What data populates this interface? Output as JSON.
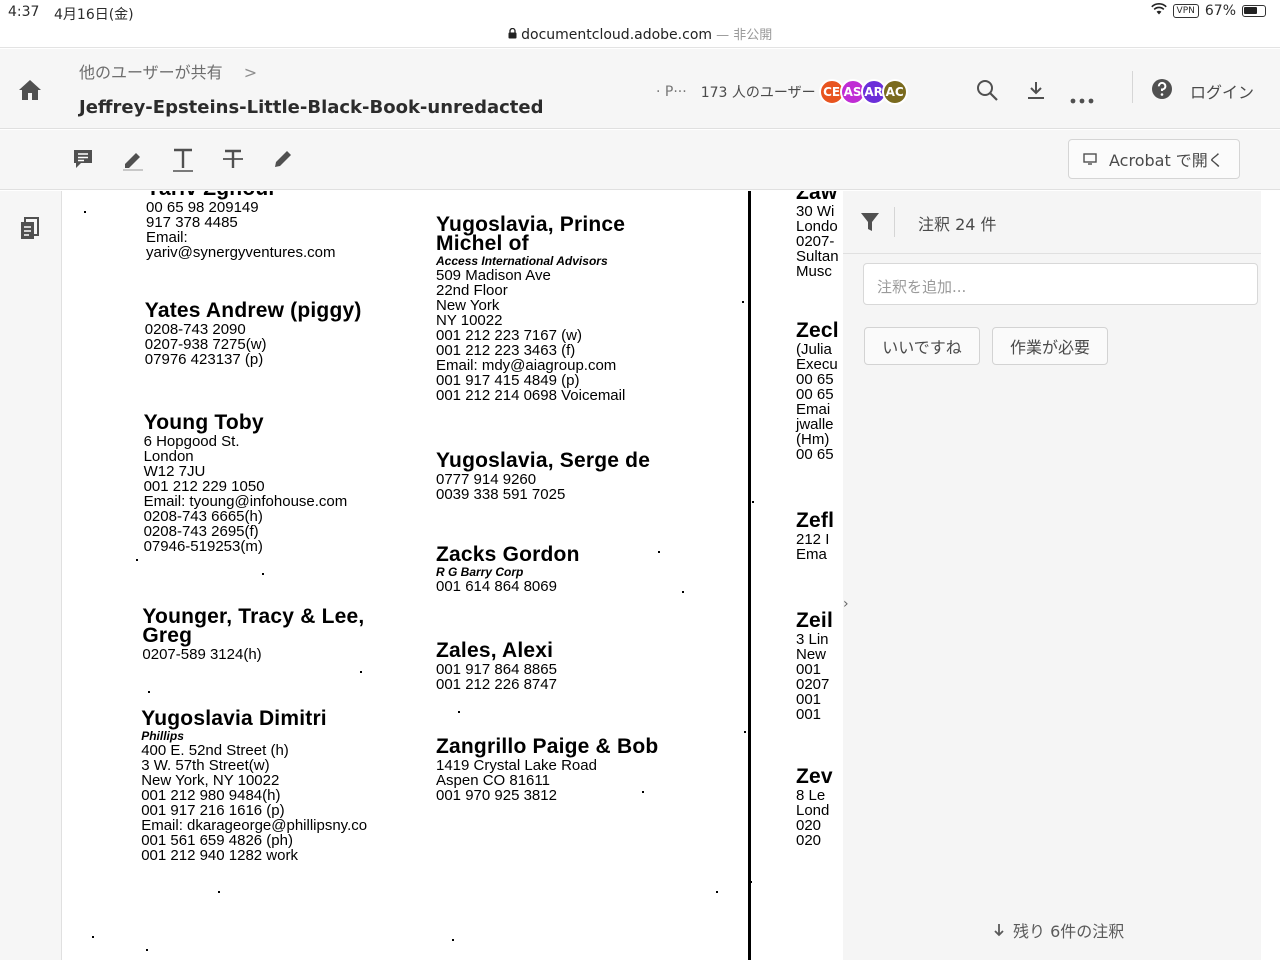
{
  "status_bar": {
    "time": "4:37",
    "date": "4月16日(金)",
    "url": "documentcloud.adobe.com",
    "url_suffix": " — 非公開",
    "vpn": "VPN",
    "battery": "67%",
    "battery_level": 0.67
  },
  "header": {
    "breadcrumb": "他のユーザーが共有",
    "breadcrumb_chevron": ">",
    "document_title": "Jeffrey-Epsteins-Little-Black-Book-unredacted",
    "users_prefix": "· P···",
    "users_label": "173 人のユーザー",
    "avatars": [
      {
        "initials": "CE",
        "color": "#e8541f"
      },
      {
        "initials": "AS",
        "color": "#c02cd4"
      },
      {
        "initials": "AR",
        "color": "#6b2fd9"
      },
      {
        "initials": "AC",
        "color": "#7a6a1e"
      }
    ],
    "login_label": "ログイン"
  },
  "toolbar": {
    "open_in_acrobat": "Acrobat で開く"
  },
  "document": {
    "column1": [
      {
        "name": "Yariv Zghoul",
        "lines": [
          "00 65 98 209149",
          "917 378 4485",
          "Email:",
          "yariv@synergyventures.com"
        ]
      },
      {
        "name": "Yates Andrew (piggy)",
        "lines": [
          "0208-743 2090",
          "0207-938 7275(w)",
          "07976 423137 (p)"
        ]
      },
      {
        "name": "Young Toby",
        "lines": [
          "6 Hopgood St.",
          "London",
          "W12 7JU",
          "001 212 229 1050",
          "Email: tyoung@infohouse.com",
          "0208-743 6665(h)",
          "0208-743 2695(f)",
          "07946-519253(m)"
        ]
      },
      {
        "name": "Younger, Tracy & Lee, Greg",
        "lines": [
          "0207-589 3124(h)"
        ]
      },
      {
        "name": "Yugoslavia Dimitri",
        "sub": "Phillips",
        "lines": [
          "400 E. 52nd Street (h)",
          "3 W. 57th Street(w)",
          "New York, NY 10022",
          "001 212 980 9484(h)",
          "001 917 216 1616 (p)",
          "Email: dkarageorge@phillipsny.co",
          "001 561 659 4826 (ph)",
          "001 212 940 1282 work"
        ]
      }
    ],
    "column2": [
      {
        "name": "Yugoslavia, Prince Michel of",
        "sub": "Access International Advisors",
        "lines": [
          "509 Madison Ave",
          "22nd Floor",
          "New York",
          "NY 10022",
          "001 212 223 7167 (w)",
          "001 212 223 3463 (f)",
          "Email: mdy@aiagroup.com",
          "001 917 415 4849 (p)",
          "001 212 214 0698 Voicemail"
        ]
      },
      {
        "name": "Yugoslavia, Serge de",
        "lines": [
          "0777 914 9260",
          "0039 338 591 7025"
        ]
      },
      {
        "name": "Zacks Gordon",
        "sub": "R G Barry Corp",
        "lines": [
          "001 614 864 8069"
        ]
      },
      {
        "name": "Zales, Alexi",
        "lines": [
          "001 917 864 8865",
          "001 212 226 8747"
        ]
      },
      {
        "name": "Zangrillo Paige & Bob",
        "lines": [
          "1419 Crystal Lake Road",
          "Aspen CO 81611",
          "001 970 925 3812"
        ]
      }
    ],
    "column3": [
      {
        "name": "Zaw",
        "lines": [
          "30 Wi",
          "Londo",
          "0207-",
          "Sultan",
          "Musc"
        ]
      },
      {
        "name": "Zecl",
        "lines": [
          "(Julia",
          "Execu",
          "00 65",
          "00 65",
          "Emai",
          "jwalle",
          "(Hm)",
          "00 65"
        ]
      },
      {
        "name": "Zefl",
        "lines": [
          "212 I",
          "Ema"
        ]
      },
      {
        "name": "Zeil",
        "lines": [
          "3 Lin",
          "New",
          "001",
          "0207",
          "001",
          "001"
        ]
      },
      {
        "name": "Zev",
        "lines": [
          "8 Le",
          "Lond",
          "020",
          "020"
        ]
      }
    ]
  },
  "comments_panel": {
    "count_label": "注釈 24 件",
    "add_placeholder": "注釈を追加...",
    "chip_like": "いいですね",
    "chip_action": "作業が必要",
    "remaining_label": "残り 6件の注釈",
    "collapse_chevron": "›"
  }
}
